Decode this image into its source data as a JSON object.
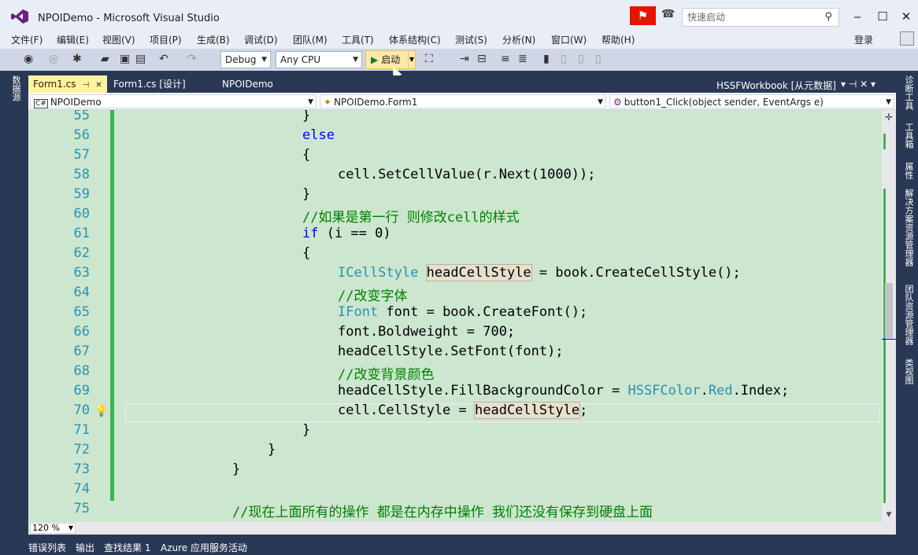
{
  "window": {
    "title": "NPOIDemo - Microsoft Visual Studio",
    "quick_launch_placeholder": "快速启动",
    "login_label": "登录",
    "minimize": "‒",
    "maximize": "☐",
    "close": "✕"
  },
  "menu": [
    "文件(F)",
    "编辑(E)",
    "视图(V)",
    "项目(P)",
    "生成(B)",
    "调试(D)",
    "团队(M)",
    "工具(T)",
    "体系结构(C)",
    "测试(S)",
    "分析(N)",
    "窗口(W)",
    "帮助(H)"
  ],
  "toolbar": {
    "config": "Debug",
    "platform": "Any CPU",
    "start_label": "启动"
  },
  "left_pane": {
    "server_explorer": "数据源"
  },
  "right_pane": [
    "诊断工具",
    "工具箱",
    "属性",
    "解决方案资源管理器",
    "团队资源管理器",
    "类视图"
  ],
  "tabs": [
    {
      "label": "Form1.cs",
      "active": true
    },
    {
      "label": "Form1.cs [设计]",
      "active": false
    },
    {
      "label": "NPOIDemo",
      "active": false
    }
  ],
  "right_doc_title": "HSSFWorkbook [从元数据]",
  "nav": {
    "project": "NPOIDemo",
    "class": "NPOIDemo.Form1",
    "member": "button1_Click(object sender, EventArgs e)"
  },
  "lines": [
    {
      "n": "55",
      "t": "}"
    },
    {
      "n": "56",
      "t": "else"
    },
    {
      "n": "57",
      "t": "{"
    },
    {
      "n": "58",
      "t": "cell.SetCellValue(r.Next(1000));"
    },
    {
      "n": "59",
      "t": "}"
    },
    {
      "n": "60",
      "t": "//如果是第一行 则修改cell的样式"
    },
    {
      "n": "61",
      "t": "if (i == 0)"
    },
    {
      "n": "62",
      "t": "{"
    },
    {
      "n": "63",
      "t": "ICellStyle headCellStyle = book.CreateCellStyle();"
    },
    {
      "n": "64",
      "t": "//改变字体"
    },
    {
      "n": "65",
      "t": "IFont font = book.CreateFont();"
    },
    {
      "n": "66",
      "t": "font.Boldweight = 700;"
    },
    {
      "n": "67",
      "t": "headCellStyle.SetFont(font);"
    },
    {
      "n": "68",
      "t": "//改变背景颜色"
    },
    {
      "n": "69",
      "t": "headCellStyle.FillBackgroundColor = HSSFColor.Red.Index;"
    },
    {
      "n": "70",
      "t": "cell.CellStyle = headCellStyle;"
    },
    {
      "n": "71",
      "t": "}"
    },
    {
      "n": "72",
      "t": "}"
    },
    {
      "n": "73",
      "t": "}"
    },
    {
      "n": "74",
      "t": ""
    },
    {
      "n": "75",
      "t": "//现在上面所有的操作 都是在内存中操作 我们还没有保存到硬盘上面"
    }
  ],
  "zoom": "120 %",
  "bottom_tabs": [
    "错误列表",
    "输出",
    "查找结果 1",
    "Azure 应用服务活动"
  ],
  "colors": {
    "editor_bg": "#cde6cf",
    "keyword": "#0000ff",
    "type": "#2b91af",
    "comment": "#008000",
    "change_bar": "#3cb54a",
    "chrome": "#293955"
  }
}
